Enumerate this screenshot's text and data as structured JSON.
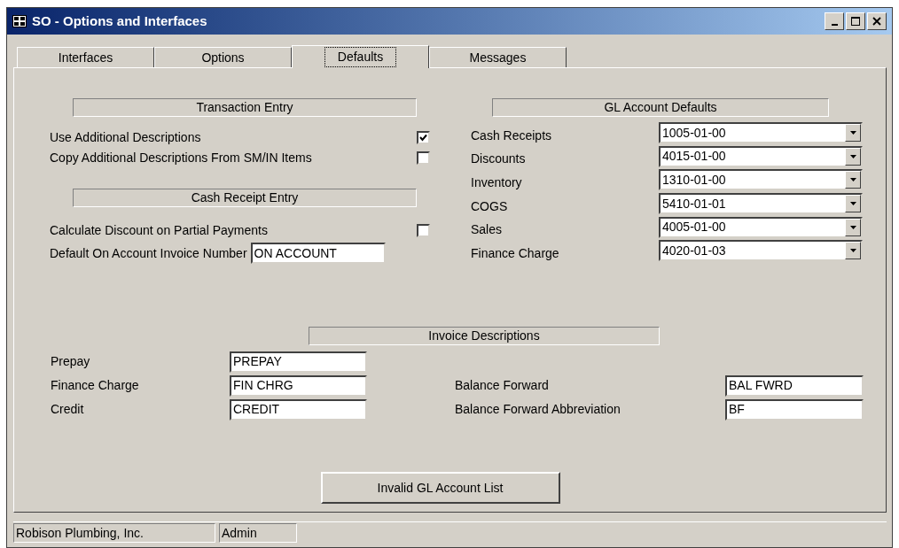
{
  "window": {
    "title": "SO - Options and Interfaces"
  },
  "tabs": [
    {
      "label": "Interfaces",
      "selected": false
    },
    {
      "label": "Options",
      "selected": false
    },
    {
      "label": "Defaults",
      "selected": true
    },
    {
      "label": "Messages",
      "selected": false
    }
  ],
  "transaction_entry": {
    "heading": "Transaction Entry",
    "options": [
      {
        "label": "Use Additional Descriptions",
        "checked": true
      },
      {
        "label": "Copy Additional Descriptions From SM/IN Items",
        "checked": false
      }
    ]
  },
  "cash_receipt_entry": {
    "heading": "Cash Receipt Entry",
    "options": [
      {
        "label": "Calculate Discount on Partial Payments",
        "checked": false
      }
    ],
    "fields": [
      {
        "label": "Default On Account Invoice Number",
        "value": "ON ACCOUNT"
      }
    ]
  },
  "gl_account_defaults": {
    "heading": "GL Account Defaults",
    "accounts": [
      {
        "label": "Cash Receipts",
        "value": "1005-01-00"
      },
      {
        "label": "Discounts",
        "value": "4015-01-00"
      },
      {
        "label": "Inventory",
        "value": "1310-01-00"
      },
      {
        "label": "COGS",
        "value": "5410-01-01"
      },
      {
        "label": "Sales",
        "value": "4005-01-00"
      },
      {
        "label": "Finance Charge",
        "value": "4020-01-03"
      }
    ]
  },
  "invoice_descriptions": {
    "heading": "Invoice Descriptions",
    "left": [
      {
        "label": "Prepay",
        "value": "PREPAY"
      },
      {
        "label": "Finance Charge",
        "value": "FIN CHRG"
      },
      {
        "label": "Credit",
        "value": "CREDIT"
      }
    ],
    "right": [
      {
        "label": "Balance Forward",
        "value": "BAL FWRD"
      },
      {
        "label": "Balance Forward Abbreviation",
        "value": "BF"
      }
    ]
  },
  "button": "Invalid GL Account List",
  "status_bar": [
    "Robison Plumbing, Inc.",
    "Admin"
  ]
}
